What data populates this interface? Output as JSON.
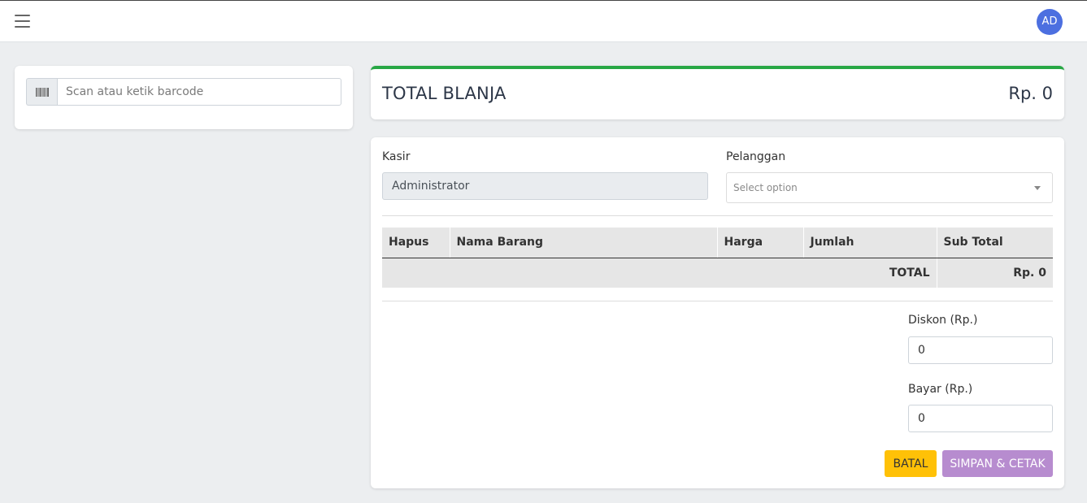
{
  "navbar": {
    "avatar_initials": "AD"
  },
  "scan": {
    "placeholder": "Scan atau ketik barcode",
    "value": ""
  },
  "summary": {
    "title": "TOTAL BLANJA",
    "amount": "Rp. 0",
    "accent_color": "#28a745"
  },
  "form": {
    "kasir_label": "Kasir",
    "kasir_value": "Administrator",
    "pelanggan_label": "Pelanggan",
    "pelanggan_placeholder": "Select option"
  },
  "cart_table": {
    "columns": [
      "Hapus",
      "Nama Barang",
      "Harga",
      "Jumlah",
      "Sub Total"
    ],
    "rows": [],
    "total_label": "TOTAL",
    "total_value": "Rp. 0"
  },
  "payment": {
    "diskon_label": "Diskon (Rp.)",
    "diskon_value": "0",
    "bayar_label": "Bayar (Rp.)",
    "bayar_value": "0"
  },
  "actions": {
    "batal_label": "BATAL",
    "simpan_label": "SIMPAN & CETAK"
  },
  "icons": {
    "menu": "hamburger-icon",
    "barcode": "barcode-icon",
    "dropdown": "chevron-down-icon"
  }
}
